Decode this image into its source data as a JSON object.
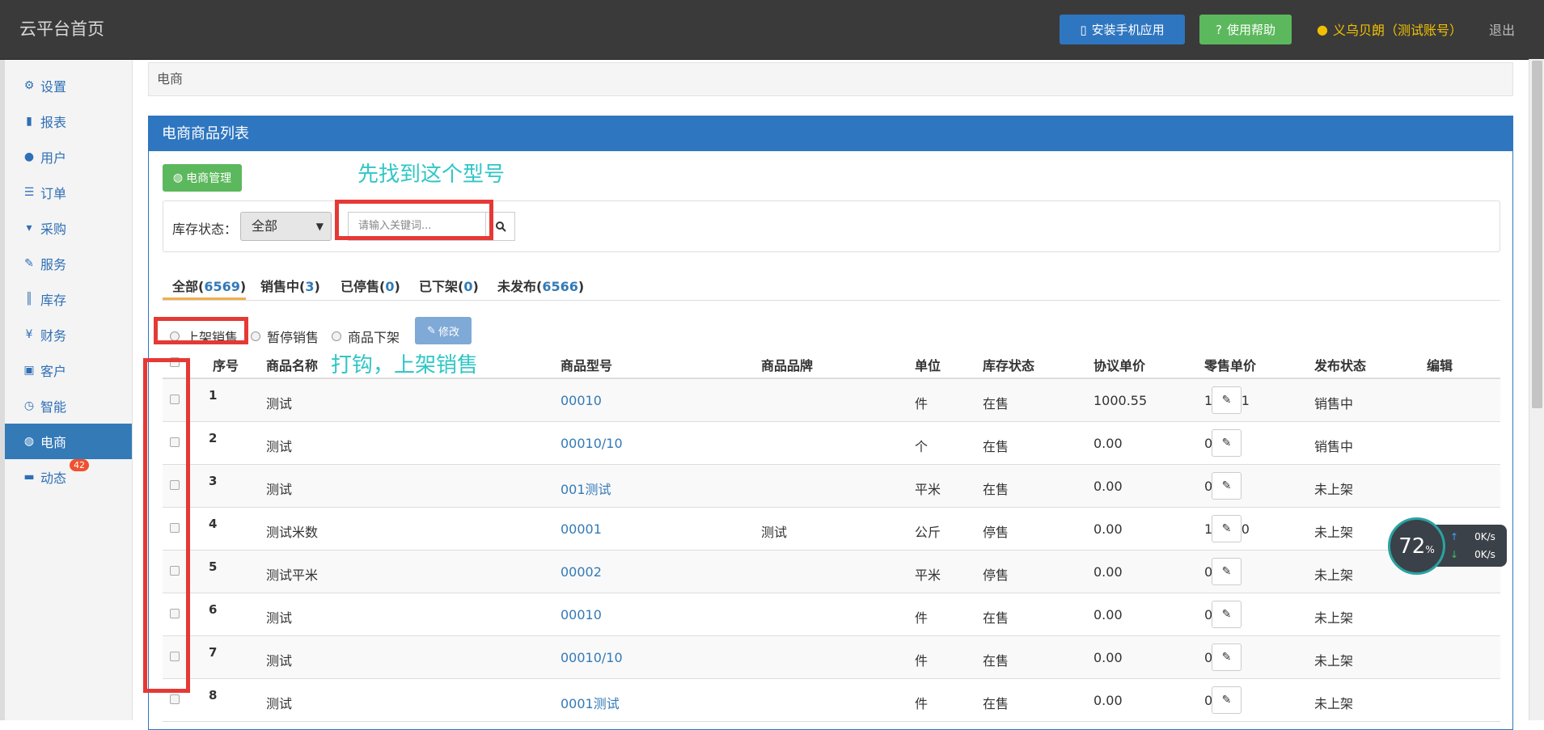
{
  "header": {
    "title": "云平台首页",
    "install_app": "安装手机应用",
    "help": "使用帮助",
    "user": "义乌贝朗（测试账号）",
    "logout": "退出"
  },
  "sidebar": {
    "items": [
      {
        "label": "设置",
        "icon": "gear-icon"
      },
      {
        "label": "报表",
        "icon": "bar-chart-icon"
      },
      {
        "label": "用户",
        "icon": "user-icon"
      },
      {
        "label": "订单",
        "icon": "list-icon"
      },
      {
        "label": "采购",
        "icon": "cart-icon"
      },
      {
        "label": "服务",
        "icon": "wrench-icon"
      },
      {
        "label": "库存",
        "icon": "barcode-icon"
      },
      {
        "label": "财务",
        "icon": "yen-icon"
      },
      {
        "label": "客户",
        "icon": "briefcase-icon"
      },
      {
        "label": "智能",
        "icon": "dashboard-icon"
      },
      {
        "label": "电商",
        "icon": "globe-icon"
      },
      {
        "label": "动态",
        "icon": "comment-icon",
        "badge": "42"
      }
    ],
    "active": "电商"
  },
  "breadcrumb": "电商",
  "panel": {
    "title": "电商商品列表",
    "mgmt_button": "电商管理",
    "annotation_find": "先找到这个型号",
    "annotation_check": "打钩，上架销售",
    "filter": {
      "stock_label": "库存状态：",
      "stock_value": "全部",
      "search_placeholder": "请输入关键词..."
    },
    "tabs": [
      {
        "label": "全部",
        "count": "6569"
      },
      {
        "label": "销售中",
        "count": "3"
      },
      {
        "label": "已停售",
        "count": "0"
      },
      {
        "label": "已下架",
        "count": "0"
      },
      {
        "label": "未发布",
        "count": "6566"
      }
    ],
    "actions": {
      "radio1": "上架销售",
      "radio2": "暂停销售",
      "radio3": "商品下架",
      "modify": "修改"
    },
    "columns": [
      "序号",
      "商品名称",
      "商品型号",
      "商品品牌",
      "单位",
      "库存状态",
      "协议单价",
      "零售单价",
      "发布状态",
      "编辑"
    ],
    "rows": [
      {
        "no": "1",
        "name": "测试",
        "model": "00010",
        "brand": "",
        "unit": "件",
        "stock": "在售",
        "contract": "1000.55",
        "retail": "110.11",
        "status": "销售中"
      },
      {
        "no": "2",
        "name": "测试",
        "model": "00010/10",
        "brand": "",
        "unit": "个",
        "stock": "在售",
        "contract": "0.00",
        "retail": "0.00",
        "status": "销售中"
      },
      {
        "no": "3",
        "name": "测试",
        "model": "001测试",
        "brand": "",
        "unit": "平米",
        "stock": "在售",
        "contract": "0.00",
        "retail": "0.00",
        "status": "未上架"
      },
      {
        "no": "4",
        "name": "测试米数",
        "model": "00001",
        "brand": "测试",
        "unit": "公斤",
        "stock": "停售",
        "contract": "0.00",
        "retail": "111.00",
        "status": "未上架"
      },
      {
        "no": "5",
        "name": "测试平米",
        "model": "00002",
        "brand": "",
        "unit": "平米",
        "stock": "停售",
        "contract": "0.00",
        "retail": "0.00",
        "status": "未上架"
      },
      {
        "no": "6",
        "name": "测试",
        "model": "00010",
        "brand": "",
        "unit": "件",
        "stock": "在售",
        "contract": "0.00",
        "retail": "0.00",
        "status": "未上架"
      },
      {
        "no": "7",
        "name": "测试",
        "model": "00010/10",
        "brand": "",
        "unit": "件",
        "stock": "在售",
        "contract": "0.00",
        "retail": "0.00",
        "status": "未上架"
      },
      {
        "no": "8",
        "name": "测试",
        "model": "0001测试",
        "brand": "",
        "unit": "件",
        "stock": "在售",
        "contract": "0.00",
        "retail": "0.00",
        "status": "未上架"
      }
    ]
  },
  "speed_widget": {
    "percent": "72",
    "percent_sign": "%",
    "up": "0",
    "down": "0",
    "unit": "K/s"
  },
  "colors": {
    "topbar": "#3a3a3a",
    "primary": "#2f76c0",
    "success": "#5cb85c",
    "annotation": "#30c6c6",
    "highlight": "#e53935",
    "user": "#f0c000"
  }
}
